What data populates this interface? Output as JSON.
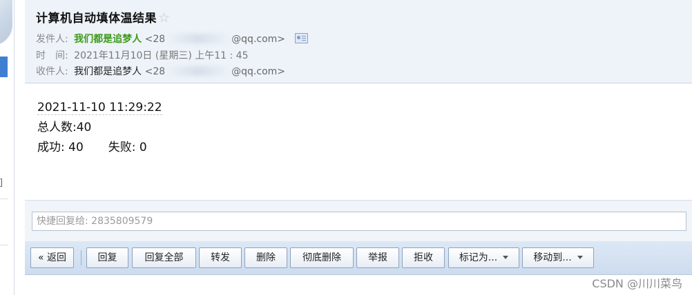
{
  "email": {
    "subject": "计算机自动填体温结果",
    "star_glyph": "☆",
    "from_label": "发件人:",
    "from_name": "我们都是追梦人",
    "from_addr_prefix": "<28",
    "from_addr_suffix": "@qq.com>",
    "time_label": "时　间:",
    "time_value": "2021年11月10日 (星期三) 上午11 : 45",
    "to_label": "收件人:",
    "to_name": "我们都是追梦人",
    "to_addr_prefix": "<28",
    "to_addr_suffix": "@qq.com>"
  },
  "body": {
    "line1": "2021-11-10 11:29:22",
    "line2": "总人数:40",
    "success": "成功: 40",
    "fail": "失败: 0"
  },
  "quick_reply": {
    "placeholder": "快捷回复给: 2835809579"
  },
  "toolbar": {
    "back": "« 返回",
    "reply": "回复",
    "reply_all": "回复全部",
    "forward": "转发",
    "delete": "删除",
    "delete_permanent": "彻底删除",
    "report": "举报",
    "reject": "拒收",
    "mark_as": "标记为...",
    "move_to": "移动到..."
  },
  "sidebar": {
    "bracket": "]"
  },
  "watermark": "CSDN @川川菜鸟",
  "colors": {
    "sender": "#3d9a1a",
    "toolbar_bg": "#cddcee",
    "header_bg": "#eef3f9"
  }
}
